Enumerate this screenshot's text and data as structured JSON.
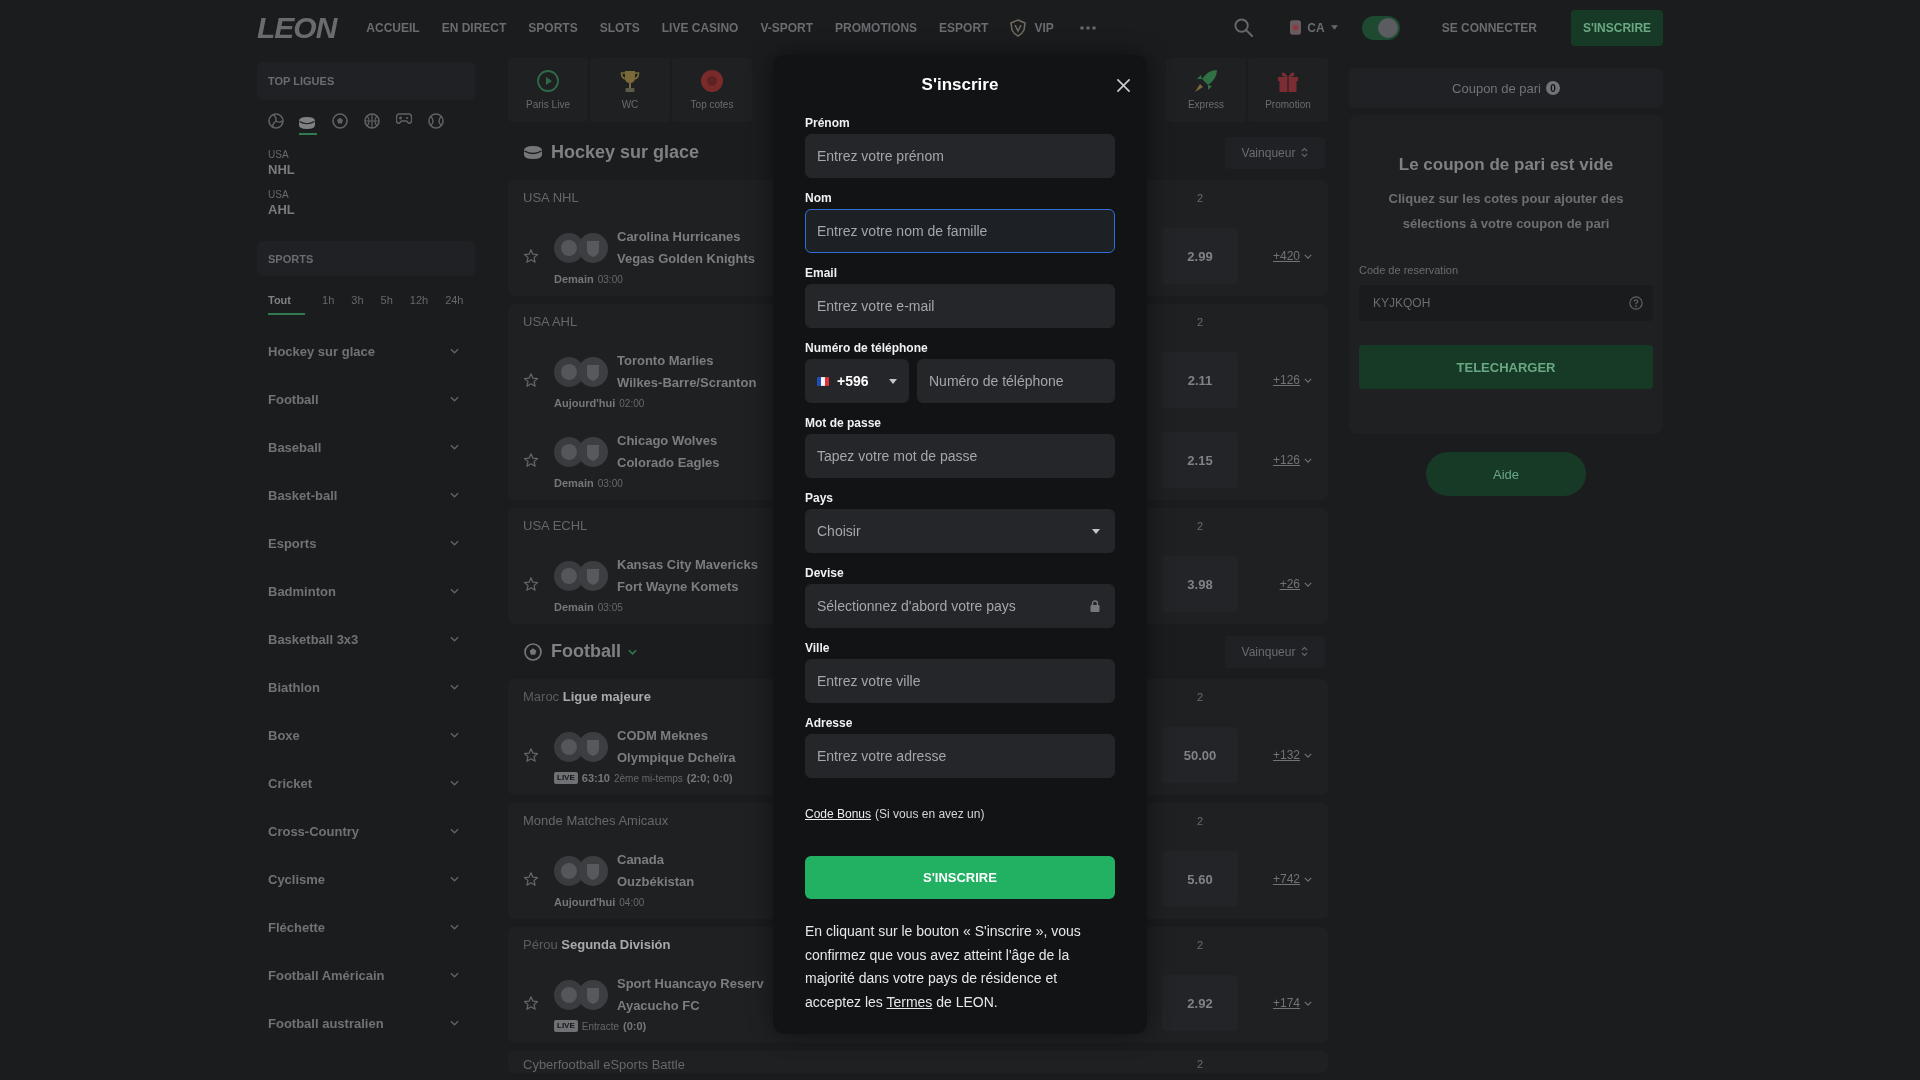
{
  "header": {
    "logo": "LEON",
    "nav": [
      {
        "label": "ACCUEIL",
        "kind": "link"
      },
      {
        "label": "EN DIRECT",
        "kind": "link"
      },
      {
        "label": "SPORTS",
        "kind": "link"
      },
      {
        "label": "SLOTS",
        "kind": "link"
      },
      {
        "label": "LIVE CASINO",
        "kind": "link"
      },
      {
        "label": "V-SPORT",
        "kind": "link"
      },
      {
        "label": "PROMOTIONS",
        "kind": "link"
      },
      {
        "label": "ESPORT",
        "kind": "link"
      },
      {
        "label": "VIP",
        "kind": "vip"
      }
    ],
    "locale": "CA",
    "theme_toggle": {
      "on": true
    },
    "login": "SE CONNECTER",
    "signup": "S'INSCRIRE"
  },
  "sidebar": {
    "top_leagues": {
      "title": "TOP LIGUES",
      "sport_tabs": [
        {
          "selected": false
        },
        {
          "selected": true
        },
        {
          "selected": false
        },
        {
          "selected": false
        },
        {
          "selected": false
        },
        {
          "selected": false
        }
      ],
      "leagues": [
        {
          "country": "USA",
          "name": "NHL"
        },
        {
          "country": "USA",
          "name": "AHL"
        }
      ]
    },
    "sports": {
      "title": "SPORTS",
      "time_filters": [
        {
          "label": "Tout",
          "selected": true
        },
        {
          "label": "1h",
          "selected": false
        },
        {
          "label": "3h",
          "selected": false
        },
        {
          "label": "5h",
          "selected": false
        },
        {
          "label": "12h",
          "selected": false
        },
        {
          "label": "24h",
          "selected": false
        }
      ],
      "items": [
        "Hockey sur glace",
        "Football",
        "Baseball",
        "Basket-ball",
        "Esports",
        "Badminton",
        "Basketball 3x3",
        "Biathlon",
        "Boxe",
        "Cricket",
        "Cross-Country",
        "Cyclisme",
        "Fléchette",
        "Football Américain",
        "Football australien"
      ]
    }
  },
  "quick_links": [
    {
      "label": "Paris Live"
    },
    {
      "label": "WC"
    },
    {
      "label": "Top cotes"
    },
    {
      "label": "Express"
    },
    {
      "label": "Promotion"
    }
  ],
  "sections": [
    {
      "title": "Hockey sur glace",
      "kind": "hockey",
      "menu_chevron": false,
      "market": "Vainqueur",
      "groups": [
        {
          "region": "USA",
          "league": "NHL",
          "league_highlighted": false,
          "column": "2",
          "matches": [
            {
              "kind": "scheduled",
              "home": "Carolina Hurricanes",
              "away": "Vegas Golden Knights",
              "day": "Demain",
              "time": "03:00",
              "odd": "2.99",
              "more": "+420"
            }
          ]
        },
        {
          "region": "USA",
          "league": "AHL",
          "league_highlighted": false,
          "column": "2",
          "matches": [
            {
              "kind": "scheduled",
              "home": "Toronto Marlies",
              "away": "Wilkes-Barre/Scranton",
              "day": "Aujourd'hui",
              "time": "02:00",
              "odd": "2.11",
              "more": "+126"
            },
            {
              "kind": "scheduled",
              "home": "Chicago Wolves",
              "away": "Colorado Eagles",
              "day": "Demain",
              "time": "03:00",
              "odd": "2.15",
              "more": "+126"
            }
          ]
        },
        {
          "region": "USA",
          "league": "ECHL",
          "league_highlighted": false,
          "column": "2",
          "matches": [
            {
              "kind": "scheduled",
              "home": "Kansas City Mavericks",
              "away": "Fort Wayne Komets",
              "day": "Demain",
              "time": "03:05",
              "odd": "3.98",
              "more": "+26"
            }
          ]
        }
      ]
    },
    {
      "title": "Football",
      "kind": "football",
      "menu_chevron": true,
      "market": "Vainqueur",
      "groups": [
        {
          "region": "Maroc",
          "league": "Ligue majeure",
          "league_highlighted": true,
          "column": "2",
          "matches": [
            {
              "kind": "live",
              "home": "CODM Meknes",
              "away": "Olympique Dcheïra",
              "badge": "LIVE",
              "clock": "63:10",
              "period": "2ème mi-temps",
              "score": "(2:0; 0:0)",
              "odd": "50.00",
              "more": "+132"
            }
          ]
        },
        {
          "region": "Monde",
          "league": "Matches Amicaux",
          "league_highlighted": false,
          "column": "2",
          "matches": [
            {
              "kind": "scheduled",
              "home": "Canada",
              "away": "Ouzbékistan",
              "day": "Aujourd'hui",
              "time": "04:00",
              "odd": "5.60",
              "more": "+742"
            }
          ]
        },
        {
          "region": "Pérou",
          "league": "Segunda División",
          "league_highlighted": true,
          "column": "2",
          "matches": [
            {
              "kind": "live",
              "home": "Sport Huancayo Reserv",
              "away": "Ayacucho FC",
              "badge": "LIVE",
              "period": "Entracte",
              "score": "(0:0)",
              "odd": "2.92",
              "more": "+174"
            }
          ]
        },
        {
          "region": "Cyberfootball",
          "league": "eSports Battle",
          "league_highlighted": false,
          "column": "2"
        }
      ]
    }
  ],
  "coupon": {
    "title": "Coupon de pari",
    "count": "0",
    "empty_title": "Le coupon de pari est vide",
    "empty_text": "Cliquez sur les cotes pour ajouter des sélections à votre coupon de pari",
    "code_label": "Code de reservation",
    "code_placeholder": "KYJKQOH",
    "load_button": "TELECHARGER"
  },
  "help_button": "Aide",
  "dialog": {
    "title": "S'inscrire",
    "fields": [
      {
        "kind": "text",
        "label": "Prénom",
        "placeholder": "Entrez votre prénom",
        "focused": false
      },
      {
        "kind": "text",
        "label": "Nom",
        "placeholder": "Entrez votre nom de famille",
        "focused": true
      },
      {
        "kind": "text",
        "label": "Email",
        "placeholder": "Entrez votre e-mail",
        "focused": false
      },
      {
        "kind": "phone",
        "label": "Numéro de téléphone",
        "code": "+596",
        "placeholder": "Numéro de téléphone",
        "focused": false
      },
      {
        "kind": "password",
        "label": "Mot de passe",
        "placeholder": "Tapez votre mot de passe",
        "focused": false
      },
      {
        "kind": "select",
        "label": "Pays",
        "placeholder": "Choisir",
        "focused": false
      },
      {
        "kind": "locked",
        "label": "Devise",
        "placeholder": "Sélectionnez d'abord votre pays",
        "focused": false
      },
      {
        "kind": "text",
        "label": "Ville",
        "placeholder": "Entrez votre ville",
        "focused": false
      },
      {
        "kind": "text",
        "label": "Adresse",
        "placeholder": "Entrez votre adresse",
        "focused": false
      }
    ],
    "bonus_link": "Code Bonus",
    "bonus_hint": "(Si vous en avez un)",
    "submit": "S'INSCRIRE",
    "terms_before": "En cliquant sur le bouton « S'inscrire », vous confirmez que vous avez atteint l'âge de la majorité dans votre pays de résidence et acceptez les",
    "terms_link": "Termes",
    "terms_after": "de LEON."
  }
}
